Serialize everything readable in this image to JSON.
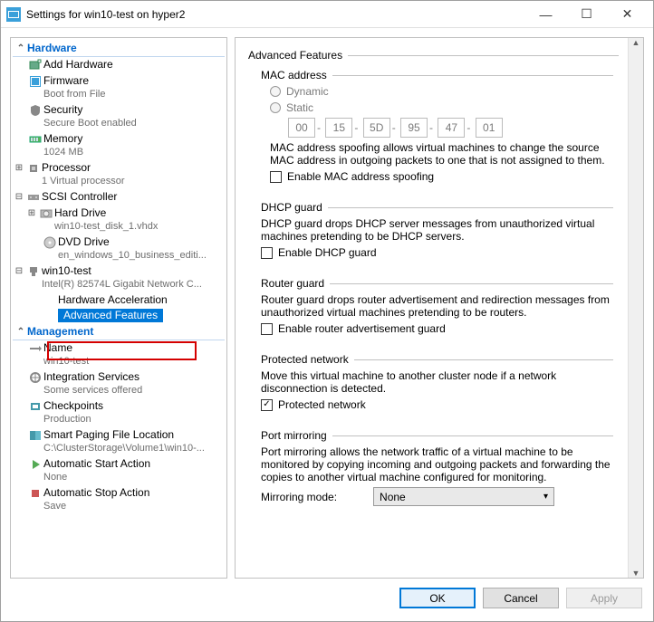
{
  "window": {
    "title": "Settings for win10-test on hyper2"
  },
  "tree": {
    "sections": {
      "hardware": "Hardware",
      "management": "Management"
    },
    "hardware": {
      "add": "Add Hardware",
      "firmware": {
        "label": "Firmware",
        "sub": "Boot from File"
      },
      "security": {
        "label": "Security",
        "sub": "Secure Boot enabled"
      },
      "memory": {
        "label": "Memory",
        "sub": "1024 MB"
      },
      "processor": {
        "label": "Processor",
        "sub": "1 Virtual processor"
      },
      "scsi": {
        "label": "SCSI Controller"
      },
      "hard_drive": {
        "label": "Hard Drive",
        "sub": "win10-test_disk_1.vhdx"
      },
      "dvd": {
        "label": "DVD Drive",
        "sub": "en_windows_10_business_editi..."
      },
      "net": {
        "label": "win10-test",
        "sub": "Intel(R) 82574L Gigabit Network C..."
      },
      "hw_accel": "Hardware Acceleration",
      "adv_feat": "Advanced Features"
    },
    "management": {
      "name": {
        "label": "Name",
        "sub": "win10-test"
      },
      "integration": {
        "label": "Integration Services",
        "sub": "Some services offered"
      },
      "checkpoints": {
        "label": "Checkpoints",
        "sub": "Production"
      },
      "smart_paging": {
        "label": "Smart Paging File Location",
        "sub": "C:\\ClusterStorage\\Volume1\\win10-..."
      },
      "auto_start": {
        "label": "Automatic Start Action",
        "sub": "None"
      },
      "auto_stop": {
        "label": "Automatic Stop Action",
        "sub": "Save"
      }
    }
  },
  "details": {
    "heading": "Advanced Features",
    "mac": {
      "title": "MAC address",
      "dynamic": "Dynamic",
      "static": "Static",
      "segments": [
        "00",
        "15",
        "5D",
        "95",
        "47",
        "01"
      ],
      "desc": "MAC address spoofing allows virtual machines to change the source MAC address in outgoing packets to one that is not assigned to them.",
      "spoof_label": "Enable MAC address spoofing"
    },
    "dhcp": {
      "title": "DHCP guard",
      "desc": "DHCP guard drops DHCP server messages from unauthorized virtual machines pretending to be DHCP servers.",
      "check": "Enable DHCP guard"
    },
    "router": {
      "title": "Router guard",
      "desc": "Router guard drops router advertisement and redirection messages from unauthorized virtual machines pretending to be routers.",
      "check": "Enable router advertisement guard"
    },
    "protected": {
      "title": "Protected network",
      "desc": "Move this virtual machine to another cluster node if a network disconnection is detected.",
      "check": "Protected network"
    },
    "mirror": {
      "title": "Port mirroring",
      "desc": "Port mirroring allows the network traffic of a virtual machine to be monitored by copying incoming and outgoing packets and forwarding the copies to another virtual machine configured for monitoring.",
      "mode_label": "Mirroring mode:",
      "mode_value": "None"
    }
  },
  "buttons": {
    "ok": "OK",
    "cancel": "Cancel",
    "apply": "Apply"
  }
}
